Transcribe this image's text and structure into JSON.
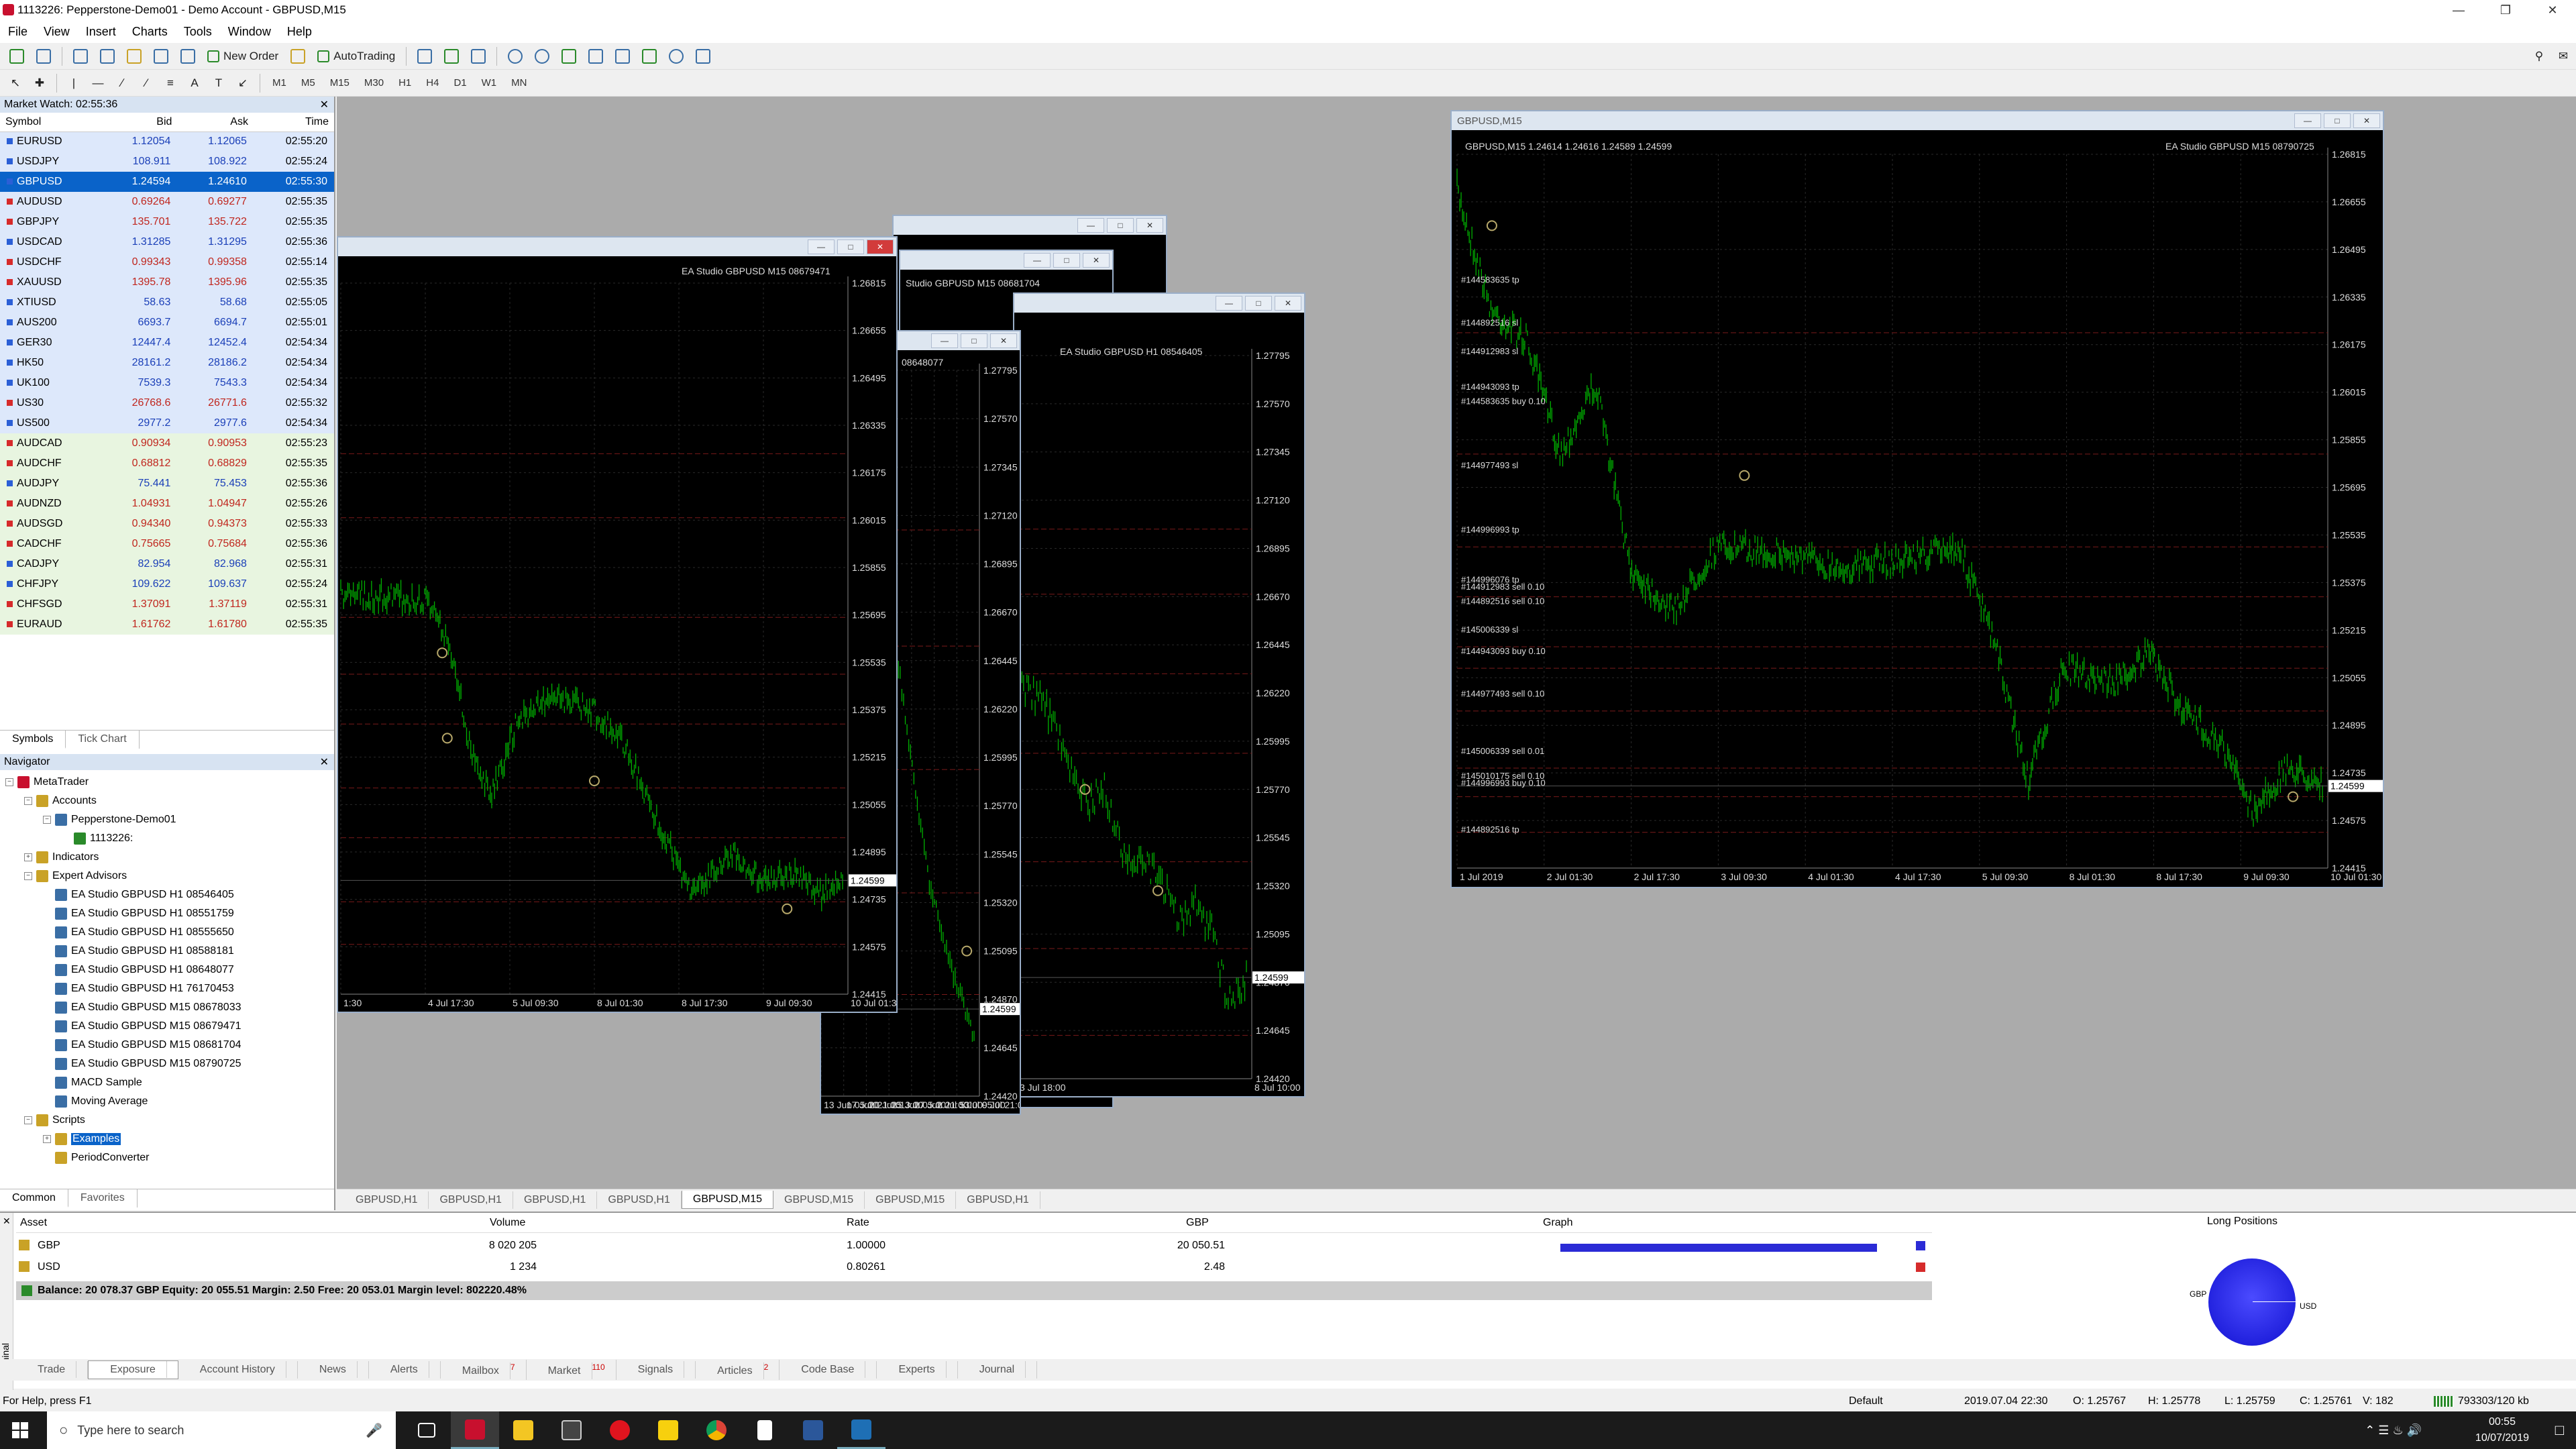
{
  "window": {
    "title": "1113226: Pepperstone-Demo01 - Demo Account - GBPUSD,M15"
  },
  "menu": [
    "File",
    "View",
    "Insert",
    "Charts",
    "Tools",
    "Window",
    "Help"
  ],
  "toolbar": {
    "new_order": "New Order",
    "autotrading": "AutoTrading",
    "timeframes": [
      "M1",
      "M5",
      "M15",
      "M30",
      "H1",
      "H4",
      "D1",
      "W1",
      "MN"
    ]
  },
  "market_watch": {
    "title": "Market Watch: 02:55:36",
    "columns": [
      "Symbol",
      "Bid",
      "Ask",
      "Time"
    ],
    "rows": [
      {
        "symbol": "EURUSD",
        "bid": "1.12054",
        "ask": "1.12065",
        "time": "02:55:20",
        "style": "blue",
        "dir": "up"
      },
      {
        "symbol": "USDJPY",
        "bid": "108.911",
        "ask": "108.922",
        "time": "02:55:24",
        "style": "blue",
        "dir": "up"
      },
      {
        "symbol": "GBPUSD",
        "bid": "1.24594",
        "ask": "1.24610",
        "time": "02:55:30",
        "style": "sel",
        "dir": "up"
      },
      {
        "symbol": "AUDUSD",
        "bid": "0.69264",
        "ask": "0.69277",
        "time": "02:55:35",
        "style": "blue",
        "dir": "dn"
      },
      {
        "symbol": "GBPJPY",
        "bid": "135.701",
        "ask": "135.722",
        "time": "02:55:35",
        "style": "blue",
        "dir": "dn"
      },
      {
        "symbol": "USDCAD",
        "bid": "1.31285",
        "ask": "1.31295",
        "time": "02:55:36",
        "style": "blue",
        "dir": "up"
      },
      {
        "symbol": "USDCHF",
        "bid": "0.99343",
        "ask": "0.99358",
        "time": "02:55:14",
        "style": "blue",
        "dir": "dn"
      },
      {
        "symbol": "XAUUSD",
        "bid": "1395.78",
        "ask": "1395.96",
        "time": "02:55:35",
        "style": "blue",
        "dir": "dn"
      },
      {
        "symbol": "XTIUSD",
        "bid": "58.63",
        "ask": "58.68",
        "time": "02:55:05",
        "style": "blue",
        "dir": "up"
      },
      {
        "symbol": "AUS200",
        "bid": "6693.7",
        "ask": "6694.7",
        "time": "02:55:01",
        "style": "blue",
        "dir": "up"
      },
      {
        "symbol": "GER30",
        "bid": "12447.4",
        "ask": "12452.4",
        "time": "02:54:34",
        "style": "blue",
        "dir": "up"
      },
      {
        "symbol": "HK50",
        "bid": "28161.2",
        "ask": "28186.2",
        "time": "02:54:34",
        "style": "blue",
        "dir": "up"
      },
      {
        "symbol": "UK100",
        "bid": "7539.3",
        "ask": "7543.3",
        "time": "02:54:34",
        "style": "blue",
        "dir": "up"
      },
      {
        "symbol": "US30",
        "bid": "26768.6",
        "ask": "26771.6",
        "time": "02:55:32",
        "style": "blue",
        "dir": "dn"
      },
      {
        "symbol": "US500",
        "bid": "2977.2",
        "ask": "2977.6",
        "time": "02:54:34",
        "style": "blue",
        "dir": "up"
      },
      {
        "symbol": "AUDCAD",
        "bid": "0.90934",
        "ask": "0.90953",
        "time": "02:55:23",
        "style": "green",
        "dir": "dn"
      },
      {
        "symbol": "AUDCHF",
        "bid": "0.68812",
        "ask": "0.68829",
        "time": "02:55:35",
        "style": "green",
        "dir": "dn"
      },
      {
        "symbol": "AUDJPY",
        "bid": "75.441",
        "ask": "75.453",
        "time": "02:55:36",
        "style": "green",
        "dir": "up"
      },
      {
        "symbol": "AUDNZD",
        "bid": "1.04931",
        "ask": "1.04947",
        "time": "02:55:26",
        "style": "green",
        "dir": "dn"
      },
      {
        "symbol": "AUDSGD",
        "bid": "0.94340",
        "ask": "0.94373",
        "time": "02:55:33",
        "style": "green",
        "dir": "dn"
      },
      {
        "symbol": "CADCHF",
        "bid": "0.75665",
        "ask": "0.75684",
        "time": "02:55:36",
        "style": "green",
        "dir": "dn"
      },
      {
        "symbol": "CADJPY",
        "bid": "82.954",
        "ask": "82.968",
        "time": "02:55:31",
        "style": "green",
        "dir": "up"
      },
      {
        "symbol": "CHFJPY",
        "bid": "109.622",
        "ask": "109.637",
        "time": "02:55:24",
        "style": "green",
        "dir": "up"
      },
      {
        "symbol": "CHFSGD",
        "bid": "1.37091",
        "ask": "1.37119",
        "time": "02:55:31",
        "style": "green",
        "dir": "dn"
      },
      {
        "symbol": "EURAUD",
        "bid": "1.61762",
        "ask": "1.61780",
        "time": "02:55:35",
        "style": "green",
        "dir": "dn"
      }
    ],
    "tabs": [
      "Symbols",
      "Tick Chart"
    ]
  },
  "navigator": {
    "title": "Navigator",
    "items": [
      {
        "label": "MetaTrader",
        "level": 0,
        "icon": "metatrader"
      },
      {
        "label": "Accounts",
        "level": 1,
        "icon": "accounts"
      },
      {
        "label": "Pepperstone-Demo01",
        "level": 2,
        "icon": "server"
      },
      {
        "label": "1113226:",
        "level": 3,
        "icon": "account"
      },
      {
        "label": "Indicators",
        "level": 1,
        "icon": "indicators"
      },
      {
        "label": "Expert Advisors",
        "level": 1,
        "icon": "experts"
      },
      {
        "label": "EA Studio GBPUSD H1  08546405",
        "level": 2,
        "icon": "ea"
      },
      {
        "label": "EA Studio GBPUSD H1  08551759",
        "level": 2,
        "icon": "ea"
      },
      {
        "label": "EA Studio GBPUSD H1  08555650",
        "level": 2,
        "icon": "ea"
      },
      {
        "label": "EA Studio GBPUSD H1  08588181",
        "level": 2,
        "icon": "ea"
      },
      {
        "label": "EA Studio GBPUSD H1  08648077",
        "level": 2,
        "icon": "ea"
      },
      {
        "label": "EA Studio GBPUSD H1  76170453",
        "level": 2,
        "icon": "ea"
      },
      {
        "label": "EA Studio GBPUSD M15  08678033",
        "level": 2,
        "icon": "ea"
      },
      {
        "label": "EA Studio GBPUSD M15  08679471",
        "level": 2,
        "icon": "ea"
      },
      {
        "label": "EA Studio GBPUSD M15  08681704",
        "level": 2,
        "icon": "ea"
      },
      {
        "label": "EA Studio GBPUSD M15  08790725",
        "level": 2,
        "icon": "ea"
      },
      {
        "label": "MACD Sample",
        "level": 2,
        "icon": "ea"
      },
      {
        "label": "Moving Average",
        "level": 2,
        "icon": "ea"
      },
      {
        "label": "Scripts",
        "level": 1,
        "icon": "scripts"
      },
      {
        "label": "Examples",
        "level": 2,
        "icon": "folder",
        "selected": true
      },
      {
        "label": "PeriodConverter",
        "level": 2,
        "icon": "script"
      }
    ],
    "tabs": [
      "Common",
      "Favorites"
    ]
  },
  "charts": {
    "main": {
      "title": "GBPUSD,M15",
      "info": "GBPUSD,M15  1.24614 1.24616 1.24589 1.24599",
      "ea_label": "EA Studio GBPUSD M15  08790725",
      "current_price": "1.24599",
      "yticks": [
        "1.26815",
        "1.26655",
        "1.26495",
        "1.26335",
        "1.26175",
        "1.26015",
        "1.25855",
        "1.25695",
        "1.25535",
        "1.25375",
        "1.25215",
        "1.25055",
        "1.24895",
        "1.24735",
        "1.24575",
        "1.24415"
      ],
      "xticks": [
        "1 Jul 2019",
        "2 Jul 01:30",
        "2 Jul 17:30",
        "3 Jul 09:30",
        "4 Jul 01:30",
        "4 Jul 17:30",
        "5 Jul 09:30",
        "8 Jul 01:30",
        "8 Jul 17:30",
        "9 Jul 09:30",
        "10 Jul 01:30"
      ],
      "orders": [
        "#144583635 tp",
        "#144892516 sl",
        "#144912983 sl",
        "#144943093 tp",
        "#144583635 buy 0.10",
        "#144977493 sl",
        "#144996993 tp",
        "#144996076 tp",
        "#144912983 sell 0.10",
        "#144892516 sell 0.10",
        "#145006339 sl",
        "#144943093 buy 0.10",
        "#144977493 sell 0.10",
        "#145006339 sell 0.01",
        "#145010175 sell 0.10",
        "#144996993 buy 0.10",
        "#144892516 tp"
      ]
    },
    "win_a": {
      "ea_label": "EA Studio GBPUSD M15  08679471",
      "current_price": "1.24599",
      "yticks": [
        "1.26815",
        "1.26655",
        "1.26495",
        "1.26335",
        "1.26175",
        "1.26015",
        "1.25855",
        "1.25695",
        "1.25535",
        "1.25375",
        "1.25215",
        "1.25055",
        "1.24895",
        "1.24735",
        "1.24575",
        "1.24415"
      ],
      "xticks": [
        "1:30",
        "4 Jul 17:30",
        "5 Jul 09:30",
        "8 Jul 01:30",
        "8 Jul 17:30",
        "9 Jul 09:30",
        "10 Jul 01:30"
      ]
    },
    "win_b": {
      "ea_label": "08648077",
      "current_price": "1.24599",
      "yticks": [
        "1.27795",
        "1.27570",
        "1.27345",
        "1.27120",
        "1.26895",
        "1.26670",
        "1.26445",
        "1.26220",
        "1.25995",
        "1.25770",
        "1.25545",
        "1.25320",
        "1.25095",
        "1.24870",
        "1.24645",
        "1.24420"
      ],
      "xticks": [
        "13 Jun 05:00",
        "17 Jun 21:00",
        "20 Jun 13:00",
        "25 Jun 05:00",
        "27 Jun 21:00",
        "2 Jul 13:00",
        "5 Jul 05:00",
        "9 Jul 21:00"
      ]
    },
    "win_c": {
      "ea_label": "EA Studio GBPUSD H1  08546405",
      "current_price": "1.24599",
      "yticks": [
        "1.27795",
        "1.27570",
        "1.27345",
        "1.27120",
        "1.26895",
        "1.26670",
        "1.26445",
        "1.26220",
        "1.25995",
        "1.25770",
        "1.25545",
        "1.25320",
        "1.25095",
        "1.24870",
        "1.24645",
        "1.24420"
      ],
      "xticks": [
        "3 Jul 18:00",
        "8 Jul 10:00"
      ]
    },
    "bg_titles": [
      "Studio GBPUSD M15 08681704"
    ]
  },
  "chart_tabs": [
    "GBPUSD,H1",
    "GBPUSD,H1",
    "GBPUSD,H1",
    "GBPUSD,H1",
    "GBPUSD,M15",
    "GBPUSD,M15",
    "GBPUSD,M15",
    "GBPUSD,H1"
  ],
  "active_chart_tab": 4,
  "terminal": {
    "columns": [
      "Asset",
      "Volume",
      "Rate",
      "GBP",
      "Graph"
    ],
    "rows": [
      {
        "asset": "GBP",
        "volume": "8 020 205",
        "rate": "1.00000",
        "gbp": "20 050.51",
        "bar_frac": 1.0,
        "color": "#2b2bd6"
      },
      {
        "asset": "USD",
        "volume": "1 234",
        "rate": "0.80261",
        "gbp": "2.48",
        "bar_frac": 0.0,
        "color": "#d62b2b"
      }
    ],
    "summary": "Balance: 20 078.37 GBP  Equity: 20 055.51  Margin: 2.50  Free: 20 053.01  Margin level: 802220.48%",
    "long_positions": {
      "title": "Long Positions",
      "labels": [
        "GBP",
        "USD"
      ]
    },
    "side_label": "Terminal"
  },
  "bottom_tabs": [
    {
      "label": "Trade"
    },
    {
      "label": "Exposure",
      "active": true
    },
    {
      "label": "Account History"
    },
    {
      "label": "News"
    },
    {
      "label": "Alerts"
    },
    {
      "label": "Mailbox",
      "badge": "7"
    },
    {
      "label": "Market",
      "badge": "110"
    },
    {
      "label": "Signals"
    },
    {
      "label": "Articles",
      "badge": "2"
    },
    {
      "label": "Code Base"
    },
    {
      "label": "Experts"
    },
    {
      "label": "Journal"
    }
  ],
  "status": {
    "help": "For Help, press F1",
    "profile": "Default",
    "datetime": "2019.07.04 22:30",
    "o": "O: 1.25767",
    "h": "H: 1.25778",
    "l": "L: 1.25759",
    "c": "C: 1.25761",
    "v": "V: 182",
    "traffic": "793303/120 kb"
  },
  "taskbar": {
    "search_placeholder": "Type here to search",
    "time": "00:55",
    "date": "10/07/2019"
  },
  "colors": {
    "candle": "#00b000",
    "background": "#000000",
    "selection": "#0a63c9",
    "workspace": "#ababab"
  }
}
